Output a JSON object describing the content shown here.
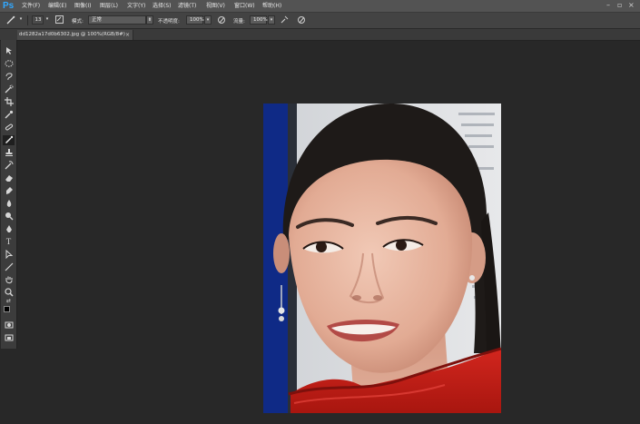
{
  "app": {
    "logo": "Ps"
  },
  "menu": {
    "items": [
      {
        "id": "file",
        "label": "文件(F)"
      },
      {
        "id": "edit",
        "label": "编辑(E)"
      },
      {
        "id": "image",
        "label": "图像(I)"
      },
      {
        "id": "layer",
        "label": "图层(L)"
      },
      {
        "id": "type",
        "label": "文字(Y)"
      },
      {
        "id": "select",
        "label": "选择(S)"
      },
      {
        "id": "filter",
        "label": "滤镜(T)"
      },
      {
        "id": "view",
        "label": "视图(V)"
      },
      {
        "id": "window",
        "label": "窗口(W)"
      },
      {
        "id": "help",
        "label": "帮助(H)"
      }
    ]
  },
  "options": {
    "brush_size": "13",
    "mode_label": "模式:",
    "mode_value": "正常",
    "opacity_label": "不透明度:",
    "opacity_value": "100%",
    "flow_label": "流量:",
    "flow_value": "100%"
  },
  "document": {
    "tab_title": "dd1282a17d0b6302.jpg @ 100%(RGB/8#)",
    "close_glyph": "×"
  },
  "colors": {
    "foreground": "#000000",
    "background": "#ffffff",
    "accent": "#31a8ff"
  },
  "icons": {
    "tools": [
      "move-icon",
      "marquee-icon",
      "lasso-icon",
      "quick-select-icon",
      "crop-icon",
      "eyedropper-icon",
      "healing-icon",
      "brush-icon",
      "clone-stamp-icon",
      "history-brush-icon",
      "eraser-icon",
      "gradient-icon",
      "blur-icon",
      "dodge-icon",
      "pen-icon",
      "type-icon",
      "path-select-icon",
      "line-icon",
      "hand-icon",
      "zoom-icon",
      "swap-colors-icon",
      "quick-mask-icon",
      "screen-mode-icon"
    ]
  }
}
